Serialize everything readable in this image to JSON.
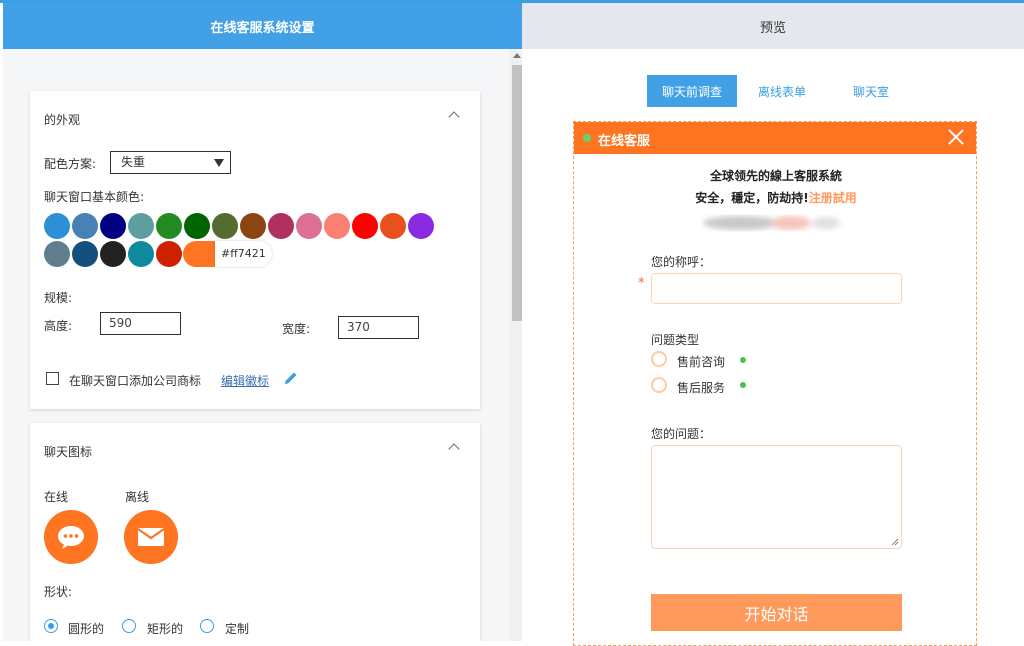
{
  "header": {
    "settings_tab": "在线客服系统设置",
    "preview_tab": "预览"
  },
  "appearance": {
    "title": "的外观",
    "scheme_label": "配色方案:",
    "scheme_value": "失重",
    "base_color_label": "聊天窗口基本颜色:",
    "colors": [
      "#2d8fd5",
      "#4682b4",
      "#000080",
      "#5f9ea0",
      "#228b22",
      "#006400",
      "#556b2f",
      "#8b4513",
      "#b03060",
      "#db7093",
      "#fa8072",
      "#ff0000",
      "#e8501e",
      "#8a2be2",
      "#5f7f8f",
      "#14507e",
      "#222222",
      "#0d8a9e",
      "#cc2200",
      "#ff7a28"
    ],
    "selected_color": "#ff7421",
    "selected_hex": "#ff7421",
    "scale_label": "规模:",
    "height_label": "高度:",
    "height_value": "590",
    "width_label": "宽度:",
    "width_value": "370",
    "logo_checkbox_label": "在聊天窗口添加公司商标",
    "edit_logo_link": "编辑徽标"
  },
  "chat_icon": {
    "title": "聊天图标",
    "online_label": "在线",
    "offline_label": "离线",
    "shape_label": "形状:",
    "shapes": [
      "圆形的",
      "矩形的",
      "定制"
    ],
    "selected_shape": "圆形的"
  },
  "preview": {
    "tabs": [
      "聊天前调查",
      "离线表单",
      "聊天室"
    ],
    "active_tab": "聊天前调查",
    "widget": {
      "title": "在线客服",
      "slogan_line1": "全球领先的線上客服系統",
      "slogan_line2": "安全，穩定，防劫持!",
      "register_link": "注册試用",
      "name_label": "您的称呼：",
      "required_mark": "*",
      "type_label": "问题类型",
      "type_options": [
        "售前咨询",
        "售后服务"
      ],
      "question_label": "您的问题：",
      "start_button": "开始对话"
    },
    "accent": "#ff7421"
  }
}
